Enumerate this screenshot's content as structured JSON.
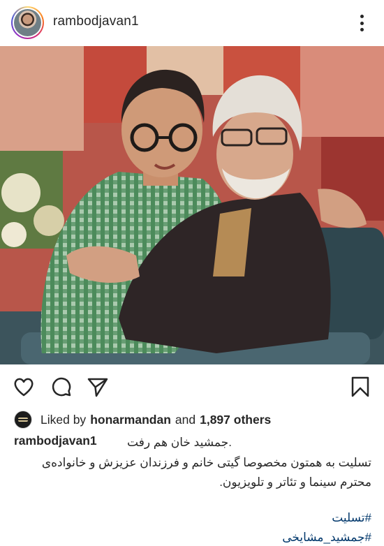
{
  "post": {
    "username": "rambodjavan1",
    "more_icon": "three-dots-vertical",
    "photo_alt_icon": "photo"
  },
  "actions": {
    "like_icon": "heart-icon",
    "comment_icon": "comment-icon",
    "share_icon": "share-icon",
    "save_icon": "bookmark-icon"
  },
  "likes": {
    "prefix": "Liked by",
    "liker": "honarmandan",
    "and": "and",
    "count": "1,897 others"
  },
  "caption": {
    "username": "rambodjavan1",
    "line1": ".جمشید خان هم رفت",
    "line2": "تسلیت به همتون مخصوصا گیتی خانم و فرزندان عزیزش و خانواده‌ی",
    "line3": "محترم سینما و تئاتر و تلویزیون.",
    "hashtags": [
      "#تسلیت",
      "#جمشید_مشایخی"
    ]
  },
  "colors": {
    "text": "#262626",
    "hashtag": "#00376b"
  }
}
